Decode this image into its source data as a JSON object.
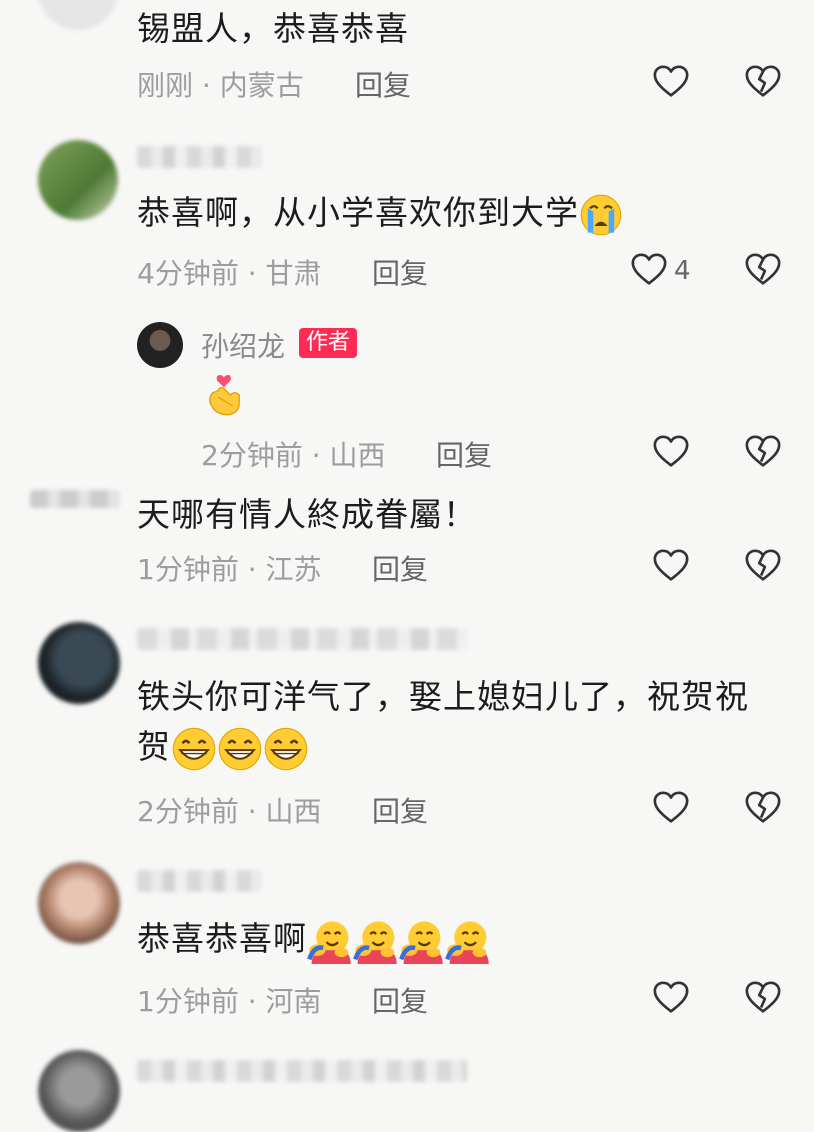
{
  "comments": [
    {
      "text": "锡盟人，恭喜恭喜",
      "time": "刚刚",
      "location": "内蒙古",
      "reply": "回复"
    },
    {
      "text": "恭喜啊，从小学喜欢你到大学",
      "time": "4分钟前",
      "location": "甘肃",
      "reply": "回复",
      "likes": "4",
      "emoji": "loudly-crying-face"
    },
    {
      "author": "孙绍龙",
      "badge": "作者",
      "emoji": "hand-heart",
      "time": "2分钟前",
      "location": "山西",
      "reply": "回复"
    },
    {
      "text": "天哪有情人終成眷屬！",
      "time": "1分钟前",
      "location": "江苏",
      "reply": "回复"
    },
    {
      "text1": "铁头你可洋气了，娶上媳妇儿了，祝贺祝",
      "text2": "贺",
      "emoji": "grinning-face x3",
      "time": "2分钟前",
      "location": "山西",
      "reply": "回复"
    },
    {
      "text": "恭喜恭喜啊",
      "emoji": "hugging-face x4",
      "time": "1分钟前",
      "location": "河南",
      "reply": "回复"
    }
  ],
  "separator": "·",
  "colors": {
    "badge": "#fe2c55",
    "meta": "#9d9d9d",
    "background": "#f7f7f6"
  },
  "icons": {
    "like": "heart-outline-icon",
    "dislike": "broken-heart-icon"
  }
}
